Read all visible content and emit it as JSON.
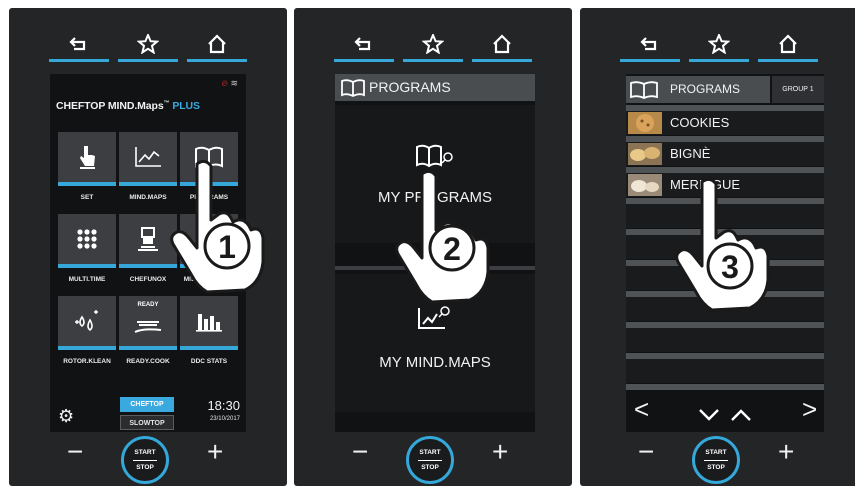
{
  "accent_color": "#35a7d9",
  "nav": {
    "icons": [
      "back-icon",
      "star-icon",
      "home-icon"
    ]
  },
  "panel1": {
    "brand_main": "CHEFTOP MIND.Maps",
    "brand_tm": "™",
    "brand_plus": "PLUS",
    "tiles": [
      {
        "label": "SET",
        "icon": "hand-touch-icon"
      },
      {
        "label": "MIND.MAPS",
        "icon": "chart-line-icon"
      },
      {
        "label": "PROGRAMS",
        "icon": "book-icon"
      },
      {
        "label": "MULTI.TIME",
        "icon": "grid-dots-icon"
      },
      {
        "label": "CHEFUNOX",
        "icon": "chef-icon"
      },
      {
        "label": "MISE EN PLACE",
        "icon": "tray-icon"
      },
      {
        "label": "ROTOR.KLEAN",
        "icon": "water-drops-icon"
      },
      {
        "label": "READY.COOK",
        "icon": "ready-tray-icon"
      },
      {
        "label": "DDC STATS",
        "icon": "bar-chart-icon"
      }
    ],
    "ready_badge": "READY",
    "mode_cheftop": "CHEFTOP",
    "mode_slowtop": "SLOWTOP",
    "time": "18:30",
    "date": "23/10/2017",
    "step": "1"
  },
  "panel2": {
    "header": "PROGRAMS",
    "item1": "MY PROGRAMS",
    "item2": "MY MIND.MAPS",
    "step": "2"
  },
  "panel3": {
    "header": "PROGRAMS",
    "group": "GROUP 1",
    "rows": [
      "COOKIES",
      "BIGNÈ",
      "MERINGUE"
    ],
    "step": "3",
    "arrows": {
      "left": "<",
      "down": "⌄",
      "up": "⌃",
      "right": ">"
    }
  },
  "controls": {
    "minus": "−",
    "plus": "+",
    "start": "START",
    "stop": "STOP"
  }
}
